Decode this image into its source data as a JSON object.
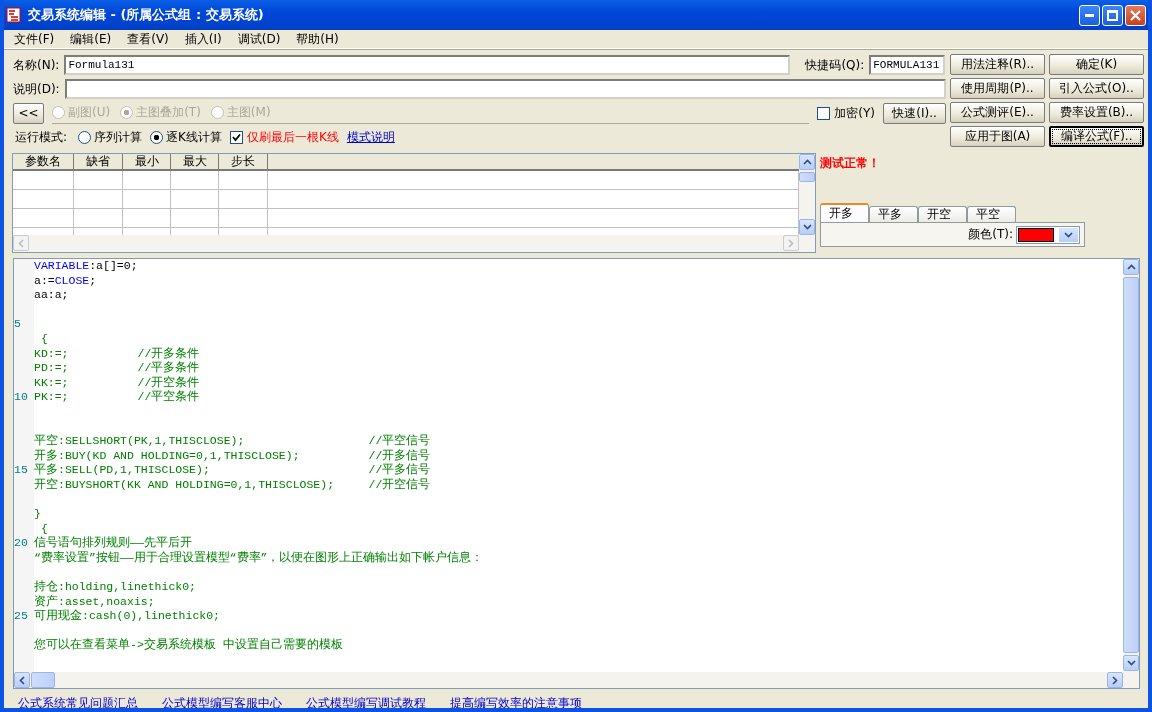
{
  "window": {
    "title": "交易系统编辑 - (所属公式组 : 交易系统)"
  },
  "menu": [
    {
      "label": "文件(F)"
    },
    {
      "label": "编辑(E)"
    },
    {
      "label": "查看(V)"
    },
    {
      "label": "插入(I)"
    },
    {
      "label": "调试(D)"
    },
    {
      "label": "帮助(H)"
    }
  ],
  "form": {
    "name_label": "名称(N):",
    "name_value": "Formula131",
    "shortcut_label": "快捷码(Q):",
    "shortcut_value": "FORMULA131",
    "desc_label": "说明(D):",
    "collapse_button": "<<",
    "chart_types": [
      {
        "label": "副图(U)",
        "selected": false,
        "disabled": true
      },
      {
        "label": "主图叠加(T)",
        "selected": true,
        "disabled": true
      },
      {
        "label": "主图(M)",
        "selected": false,
        "disabled": true
      }
    ],
    "encrypt": {
      "label": "加密(Y)",
      "checked": false
    },
    "quick_button": "快速(I)..",
    "run_mode_label": "运行模式:",
    "run_modes": [
      {
        "label": "序列计算",
        "selected": false
      },
      {
        "label": "逐K线计算",
        "selected": true
      }
    ],
    "last_bar": {
      "label": "仅刷最后一根K线",
      "checked": true
    },
    "mode_link": "模式说明"
  },
  "buttons": [
    {
      "label": "用法注释(R)..",
      "default": false
    },
    {
      "label": "确定(K)",
      "default": false
    },
    {
      "label": "使用周期(P)..",
      "default": false
    },
    {
      "label": "引入公式(O)..",
      "default": false
    },
    {
      "label": "公式测评(E)..",
      "default": false
    },
    {
      "label": "费率设置(B)..",
      "default": false
    },
    {
      "label": "应用于图(A)",
      "default": false
    },
    {
      "label": "编译公式(F)..",
      "default": true
    }
  ],
  "params": {
    "columns": [
      "参数名",
      "缺省",
      "最小",
      "最大",
      "步长"
    ]
  },
  "status": "测试正常！",
  "signal_tabs": [
    {
      "label": "开多",
      "selected": true
    },
    {
      "label": "平多",
      "selected": false
    },
    {
      "label": "开空",
      "selected": false
    },
    {
      "label": "平空",
      "selected": false
    }
  ],
  "color_picker": {
    "label": "颜色(T):",
    "color": "#ff0000"
  },
  "editor": {
    "lines": [
      {
        "kind": "code",
        "segments": [
          {
            "text": "VARIABLE",
            "kind": "keyword"
          },
          {
            "text": ":a[]=0;",
            "kind": "normal"
          }
        ]
      },
      {
        "kind": "code",
        "segments": [
          {
            "text": "a:=",
            "kind": "normal"
          },
          {
            "text": "CLOSE",
            "kind": "keyword"
          },
          {
            "text": ";",
            "kind": "normal"
          }
        ]
      },
      {
        "kind": "code",
        "segments": [
          {
            "text": "aa:a;",
            "kind": "normal"
          }
        ]
      },
      {
        "kind": "blank"
      },
      {
        "kind": "blank",
        "number": "5"
      },
      {
        "kind": "code",
        "segments": [
          {
            "text": " {",
            "kind": "formula"
          }
        ]
      },
      {
        "kind": "code",
        "segments": [
          {
            "text": "KD:=;          //开多条件",
            "kind": "formula"
          }
        ]
      },
      {
        "kind": "code",
        "segments": [
          {
            "text": "PD:=;          //平多条件",
            "kind": "formula"
          }
        ]
      },
      {
        "kind": "code",
        "segments": [
          {
            "text": "KK:=;          //开空条件",
            "kind": "formula"
          }
        ]
      },
      {
        "kind": "code",
        "number": "10",
        "segments": [
          {
            "text": "PK:=;          //平空条件",
            "kind": "formula"
          }
        ]
      },
      {
        "kind": "blank"
      },
      {
        "kind": "blank"
      },
      {
        "kind": "code",
        "segments": [
          {
            "text": "平空:SELLSHORT(PK,1,THISCLOSE);                  //平空信号",
            "kind": "formula"
          }
        ]
      },
      {
        "kind": "code",
        "segments": [
          {
            "text": "开多:BUY(KD AND HOLDING=0,1,THISCLOSE);          //开多信号",
            "kind": "formula"
          }
        ]
      },
      {
        "kind": "code",
        "number": "15",
        "segments": [
          {
            "text": "平多:SELL(PD,1,THISCLOSE);                       //平多信号",
            "kind": "formula"
          }
        ]
      },
      {
        "kind": "code",
        "segments": [
          {
            "text": "开空:BUYSHORT(KK AND HOLDING=0,1,THISCLOSE);     //开空信号",
            "kind": "formula"
          }
        ]
      },
      {
        "kind": "blank"
      },
      {
        "kind": "code",
        "segments": [
          {
            "text": "}",
            "kind": "formula"
          }
        ]
      },
      {
        "kind": "code",
        "segments": [
          {
            "text": " {",
            "kind": "formula"
          }
        ]
      },
      {
        "kind": "code",
        "number": "20",
        "segments": [
          {
            "text": "信号语句排列规则——先平后开",
            "kind": "formula"
          }
        ]
      },
      {
        "kind": "code",
        "segments": [
          {
            "text": "“费率设置”按钮——用于合理设置模型“费率”，以便在图形上正确输出如下帐户信息：",
            "kind": "formula"
          }
        ]
      },
      {
        "kind": "blank"
      },
      {
        "kind": "code",
        "segments": [
          {
            "text": "持仓:holding,linethick0;",
            "kind": "formula"
          }
        ]
      },
      {
        "kind": "code",
        "segments": [
          {
            "text": "资产:asset,noaxis;",
            "kind": "formula"
          }
        ]
      },
      {
        "kind": "code",
        "number": "25",
        "segments": [
          {
            "text": "可用现金:cash(0),linethick0;",
            "kind": "formula"
          }
        ]
      },
      {
        "kind": "blank"
      },
      {
        "kind": "code",
        "segments": [
          {
            "text": "您可以在查看菜单->交易系统模板 中设置自己需要的模板",
            "kind": "formula"
          }
        ]
      }
    ]
  },
  "footer_links": [
    "公式系统常见问题汇总",
    "公式模型编写客服中心",
    "公式模型编写调试教程",
    "提高编写效率的注意事项"
  ]
}
